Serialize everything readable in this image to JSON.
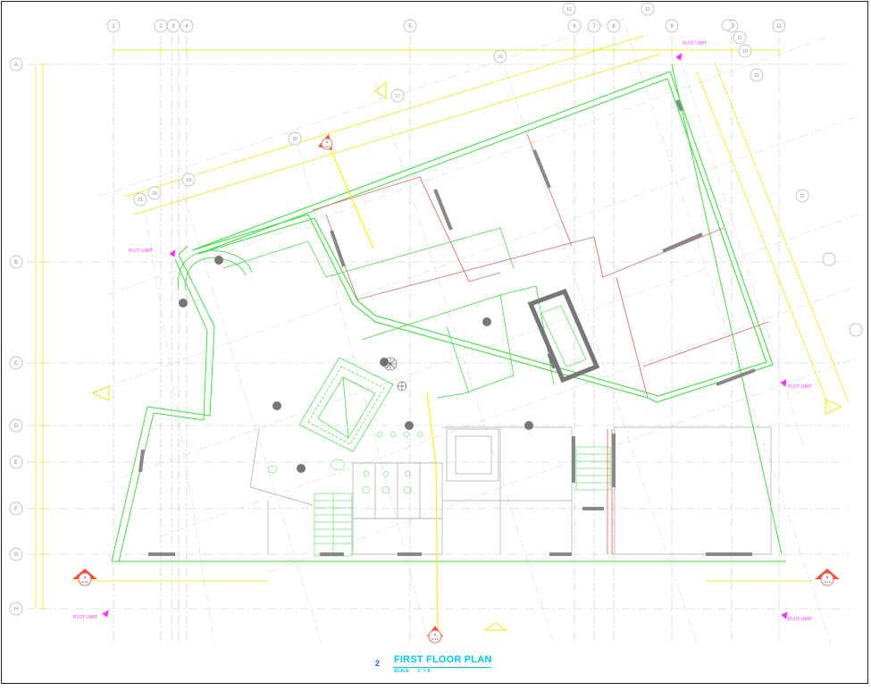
{
  "title": {
    "number": "2",
    "name": "FIRST FLOOR PLAN",
    "scale_label": "SCALE",
    "scale_value": "1\" = 8'"
  },
  "colors": {
    "grid": "#c8c8c8",
    "bubble": "#b0b0b0",
    "wall_green": "#33dd33",
    "wall_red": "#e07070",
    "dim": "#e6e600",
    "yellow_line": "#ffee00",
    "magenta": "#ff33ff",
    "window": "#888888",
    "column": "#777777",
    "marker_red": "#ee5544",
    "title_cyan": "#00c8f0",
    "title_blue": "#1a5cff"
  },
  "grid_row_labels": [
    "A",
    "B",
    "C",
    "D",
    "E",
    "F",
    "G",
    "H"
  ],
  "grid_col_labels": [
    "1",
    "2",
    "3",
    "4",
    "5",
    "6",
    "7",
    "8",
    "9",
    "10",
    "11"
  ],
  "extra_bubbles": [
    "13",
    "12",
    "11",
    "10",
    "15",
    "16",
    "17",
    "18",
    "19",
    "20",
    "21",
    "22"
  ],
  "plot_limit_label": "PLOT LIMIT",
  "section_markers": [
    {
      "letter": "B",
      "sheet": "A-3.1"
    },
    {
      "letter": "B",
      "sheet": "A-3.1"
    },
    {
      "letter": "A",
      "sheet": "A-3.1"
    },
    {
      "letter": "A",
      "sheet": "A-3.1"
    }
  ]
}
